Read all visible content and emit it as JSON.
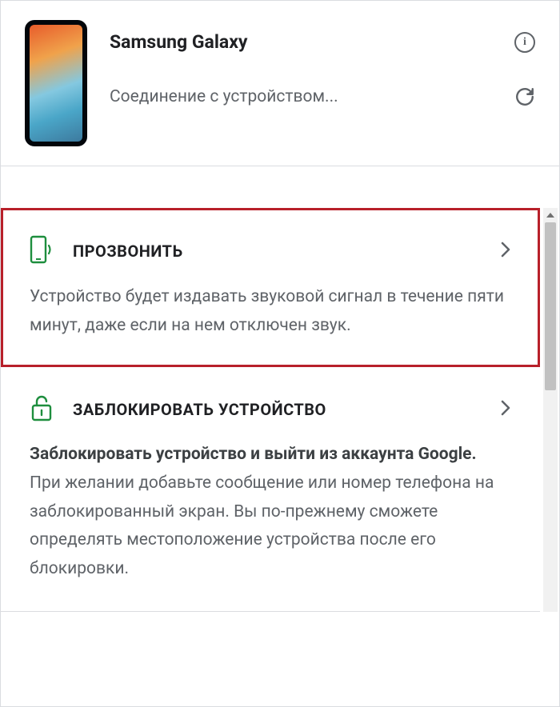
{
  "header": {
    "device_name": "Samsung Galaxy",
    "status": "Соединение с устройством..."
  },
  "actions": {
    "ring": {
      "title": "ПРОЗВОНИТЬ",
      "description": "Устройство будет издавать звуковой сигнал в течение пяти минут, даже если на нем отключен звук."
    },
    "lock": {
      "title": "ЗАБЛОКИРОВАТЬ УСТРОЙСТВО",
      "description_bold": "Заблокировать устройство и выйти из аккаунта Google.",
      "description_rest": " При желании добавьте сообщение или номер телефона на заблокированный экран. Вы по-прежнему сможете определять местоположение устройства после его блокировки."
    }
  },
  "colors": {
    "accent": "#1e8e3e",
    "highlight_border": "#b8202a"
  }
}
